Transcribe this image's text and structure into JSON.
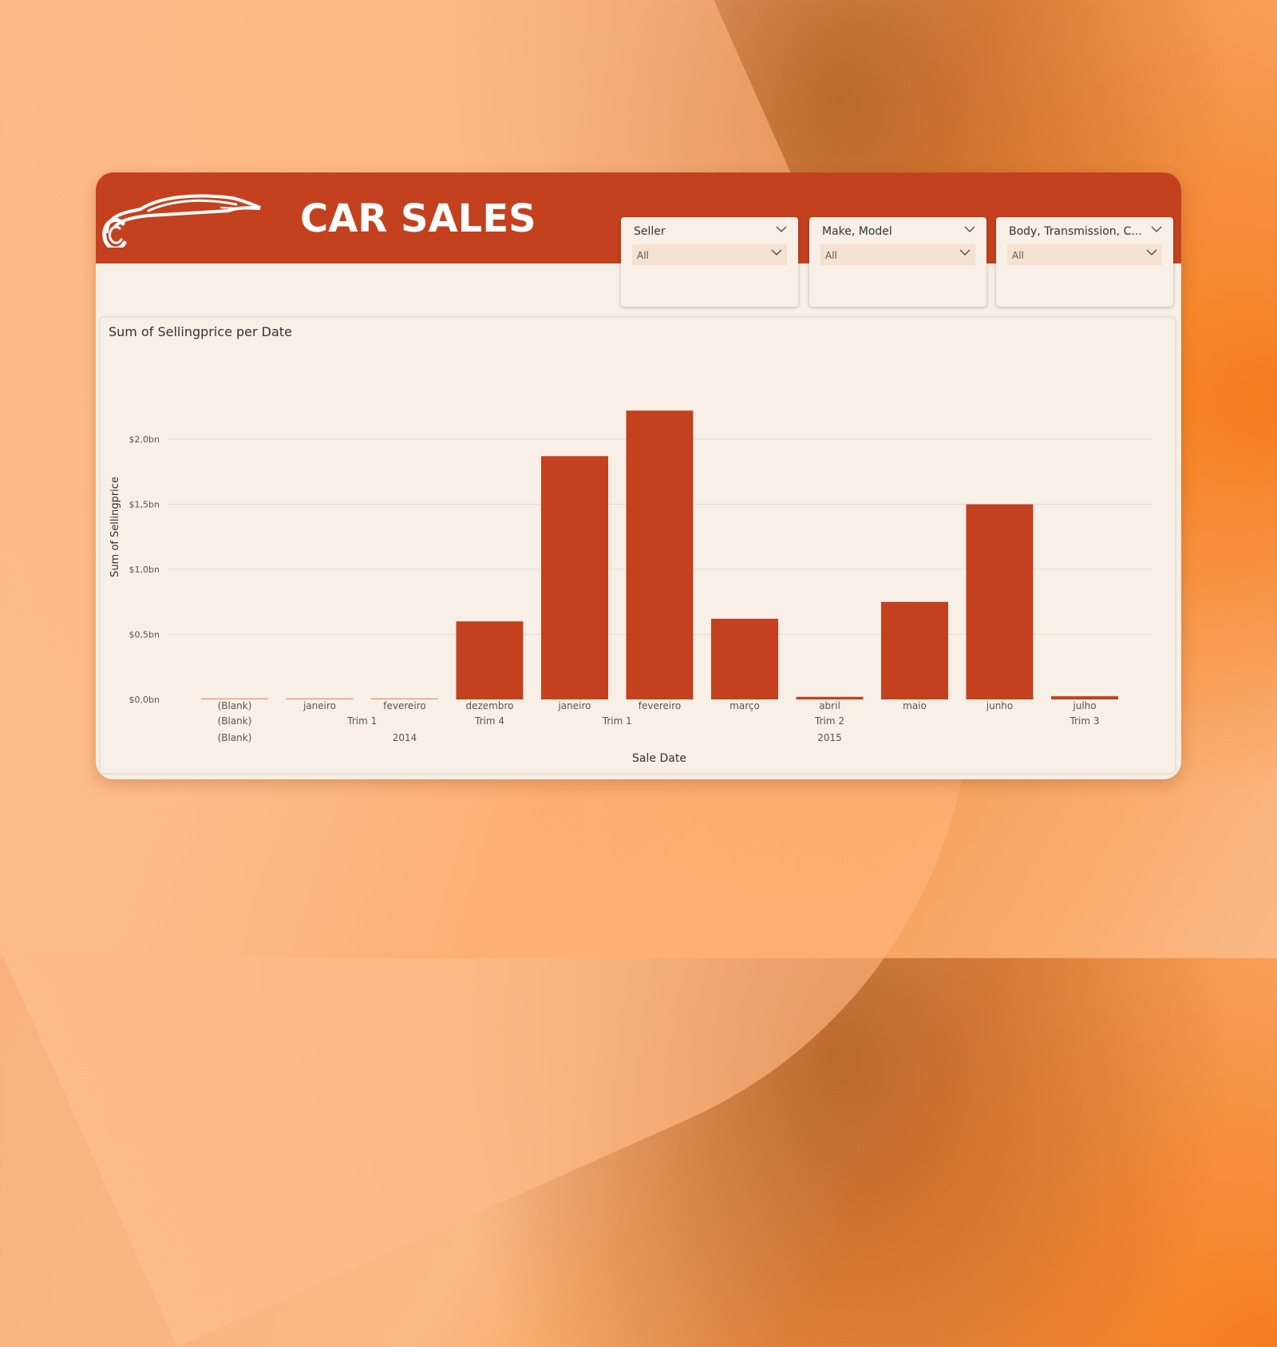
{
  "header": {
    "title": "CAR SALES"
  },
  "slicers": [
    {
      "label": "Seller",
      "value": "All"
    },
    {
      "label": "Make, Model",
      "value": "All"
    },
    {
      "label": "Body, Transmission, C...",
      "value": "All"
    }
  ],
  "icons": {
    "logo": "car-silhouette-icon",
    "dropdown": "chevron-down-icon"
  },
  "colors": {
    "accent": "#c4411f",
    "background": "#f8efe6"
  },
  "chart_data": {
    "type": "bar",
    "title": "Sum of Sellingprice per Date",
    "xlabel": "Sale Date",
    "ylabel": "Sum of Sellingprice",
    "ylim": [
      0,
      2.4
    ],
    "yticks": [
      {
        "value": 0,
        "label": "$0,0bn"
      },
      {
        "value": 0.5,
        "label": "$0,5bn"
      },
      {
        "value": 1.0,
        "label": "$1,0bn"
      },
      {
        "value": 1.5,
        "label": "$1,5bn"
      },
      {
        "value": 2.0,
        "label": "$2,0bn"
      }
    ],
    "grid": true,
    "categories": [
      "(Blank)",
      "janeiro",
      "fevereiro",
      "dezembro",
      "janeiro",
      "fevereiro",
      "março",
      "abril",
      "maio",
      "junho",
      "julho"
    ],
    "values": [
      0.005,
      0.005,
      0.005,
      0.6,
      1.87,
      2.22,
      0.62,
      0.02,
      0.75,
      1.5,
      0.025
    ],
    "hierarchy": {
      "quarters": [
        {
          "label": "(Blank)",
          "from": 0,
          "to": 0
        },
        {
          "label": "Trim 1",
          "from": 1,
          "to": 2
        },
        {
          "label": "Trim 4",
          "from": 3,
          "to": 3
        },
        {
          "label": "Trim 1",
          "from": 4,
          "to": 5
        },
        {
          "label": "Trim 2",
          "from": 6,
          "to": 8
        },
        {
          "label": "Trim 3",
          "from": 10,
          "to": 10
        }
      ],
      "years": [
        {
          "label": "(Blank)",
          "from": 0,
          "to": 0
        },
        {
          "label": "2014",
          "from": 1,
          "to": 3
        },
        {
          "label": "2015",
          "from": 4,
          "to": 10
        }
      ]
    }
  }
}
